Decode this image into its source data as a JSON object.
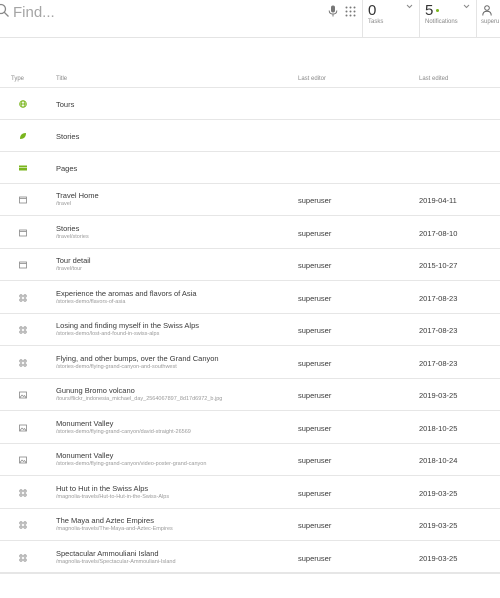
{
  "search": {
    "placeholder": "Find..."
  },
  "header": {
    "tasks": {
      "count": "0",
      "label": "Tasks"
    },
    "notifications": {
      "count": "5",
      "label": "Notifications"
    },
    "user": {
      "label": "superu"
    }
  },
  "columns": {
    "type": "Type",
    "title": "Title",
    "last_editor": "Last editor",
    "last_edited": "Last edited"
  },
  "apps": [
    {
      "icon": "tours-globe-icon",
      "title": "Tours"
    },
    {
      "icon": "stories-leaf-icon",
      "title": "Stories"
    },
    {
      "icon": "pages-icon",
      "title": "Pages"
    }
  ],
  "rows": [
    {
      "icon": "page-icon",
      "title": "Travel Home",
      "path": "/travel",
      "editor": "superuser",
      "edited": "2019-04-11"
    },
    {
      "icon": "page-icon",
      "title": "Stories",
      "path": "/travel/stories",
      "editor": "superuser",
      "edited": "2017-08-10"
    },
    {
      "icon": "page-icon",
      "title": "Tour detail",
      "path": "/travel/tour",
      "editor": "superuser",
      "edited": "2015-10-27"
    },
    {
      "icon": "story-icon",
      "title": "Experience the aromas and flavors of Asia",
      "path": "/stories-demo/flavors-of-asia",
      "editor": "superuser",
      "edited": "2017-08-23"
    },
    {
      "icon": "story-icon",
      "title": "Losing and finding myself in the Swiss Alps",
      "path": "/stories-demo/lost-and-found-in-swiss-alps",
      "editor": "superuser",
      "edited": "2017-08-23"
    },
    {
      "icon": "story-icon",
      "title": "Flying, and other bumps, over the Grand Canyon",
      "path": "/stories-demo/flying-grand-canyon-and-southwest",
      "editor": "superuser",
      "edited": "2017-08-23"
    },
    {
      "icon": "image-icon",
      "title": "Gunung Bromo volcano",
      "path": "/tours/flickr_indonesia_michael_day_2564067897_8d17d6972_b.jpg",
      "editor": "superuser",
      "edited": "2019-03-25"
    },
    {
      "icon": "image-icon",
      "title": "Monument Valley",
      "path": "/stories-demo/flying-grand-canyon/david-straight-26569",
      "editor": "superuser",
      "edited": "2018-10-25"
    },
    {
      "icon": "image-icon",
      "title": "Monument Valley",
      "path": "/stories-demo/flying-grand-canyon/video-poster-grand-canyon",
      "editor": "superuser",
      "edited": "2018-10-24"
    },
    {
      "icon": "story-icon",
      "title": "Hut to Hut in the Swiss Alps",
      "path": "/magnolia-travels/Hut-to-Hut-in-the-Swiss-Alps",
      "editor": "superuser",
      "edited": "2019-03-25"
    },
    {
      "icon": "story-icon",
      "title": "The Maya and Aztec Empires",
      "path": "/magnolia-travels/The-Maya-and-Aztec-Empires",
      "editor": "superuser",
      "edited": "2019-03-25"
    },
    {
      "icon": "story-icon",
      "title": "Spectacular Ammouliani Island",
      "path": "/magnolia-travels/Spectacular-Ammouliani-Island",
      "editor": "superuser",
      "edited": "2019-03-25"
    }
  ],
  "colors": {
    "accent": "#7ab51d",
    "text": "#3a3a3a",
    "muted": "#9a9a9a",
    "divider": "#e6e6e6"
  }
}
